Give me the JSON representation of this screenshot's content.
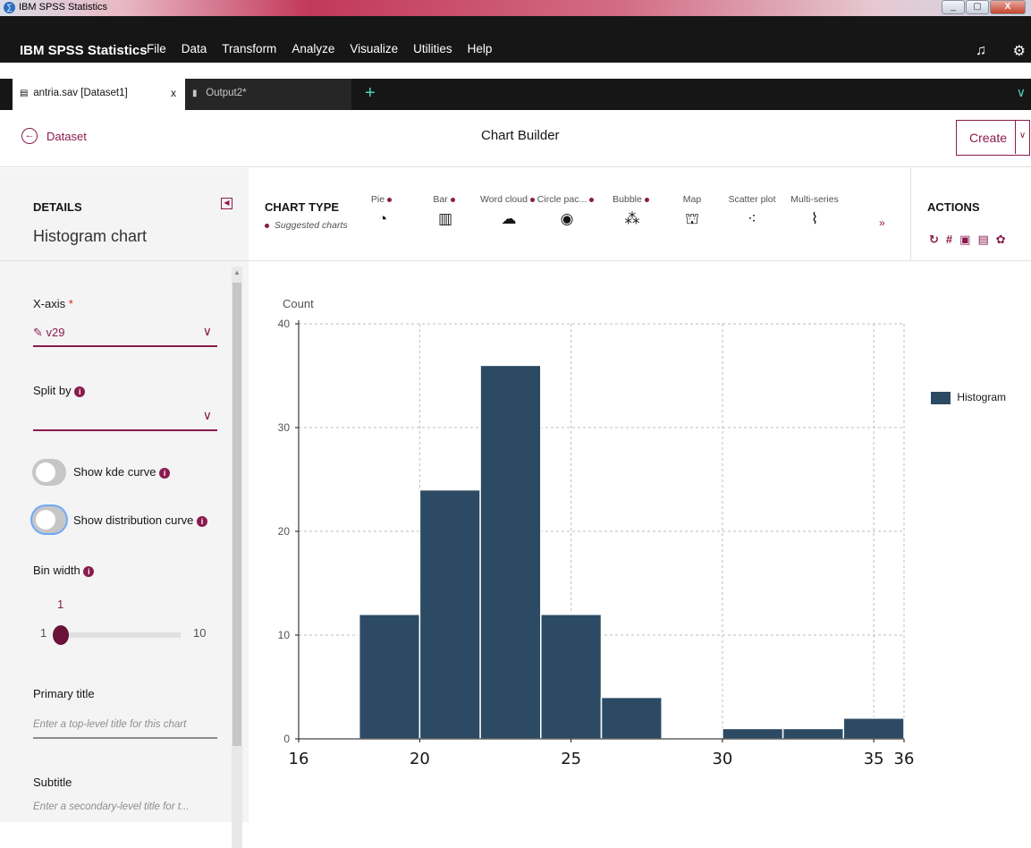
{
  "window": {
    "title": "IBM SPSS Statistics",
    "controls": [
      "_",
      "▢",
      "X"
    ]
  },
  "menubar": {
    "brand": "IBM SPSS Statistics",
    "menus": [
      "File",
      "Data",
      "Transform",
      "Analyze",
      "Visualize",
      "Utilities",
      "Help"
    ],
    "icons": [
      "bell-icon",
      "gear-icon"
    ]
  },
  "tabs": [
    {
      "label": "antria.sav [Dataset1]",
      "icon": "dataset-icon",
      "active": true,
      "close": "x"
    },
    {
      "label": "Output2*",
      "icon": "output-icon",
      "active": false
    }
  ],
  "topbar": {
    "back_label": "Dataset",
    "title": "Chart Builder",
    "create_label": "Create"
  },
  "details": {
    "label": "DETAILS",
    "title": "Histogram chart",
    "xaxis_label": "X-axis",
    "xaxis_required": "*",
    "xaxis_value": "v29",
    "splitby_label": "Split by",
    "kde_label": "Show kde curve",
    "dist_label": "Show distribution curve",
    "binwidth_label": "Bin width",
    "bin_value": "1",
    "bin_min": "1",
    "bin_max": "10",
    "primary_title_label": "Primary title",
    "primary_title_placeholder": "Enter a top-level title for this chart",
    "subtitle_label": "Subtitle",
    "subtitle_placeholder": "Enter a secondary-level title for t..."
  },
  "chart_types": {
    "label": "CHART TYPE",
    "suggested": "Suggested charts",
    "items": [
      {
        "label": "Pie",
        "suggested": true,
        "icon": "pie-icon"
      },
      {
        "label": "Bar",
        "suggested": true,
        "icon": "bar-icon"
      },
      {
        "label": "Word cloud",
        "suggested": true,
        "icon": "word-cloud-icon"
      },
      {
        "label": "Circle pac...",
        "suggested": true,
        "icon": "circle-pack-icon"
      },
      {
        "label": "Bubble",
        "suggested": true,
        "icon": "bubble-icon"
      },
      {
        "label": "Map",
        "suggested": false,
        "icon": "map-icon"
      },
      {
        "label": "Scatter plot",
        "suggested": false,
        "icon": "scatter-icon"
      },
      {
        "label": "Multi-series",
        "suggested": false,
        "icon": "multi-series-icon"
      }
    ]
  },
  "actions": {
    "label": "ACTIONS",
    "icons": [
      "refresh-icon",
      "hash-icon",
      "export-icon",
      "save-icon",
      "settings-icon"
    ]
  },
  "colors": {
    "accent": "#8a1b4d",
    "bar": "#2c4a63",
    "dark": "#161616"
  },
  "chart_data": {
    "type": "bar",
    "ylabel": "Count",
    "xlim": [
      16,
      36
    ],
    "ylim": [
      0,
      40
    ],
    "yticks": [
      0,
      10,
      20,
      30,
      40
    ],
    "xticks": [
      16,
      20,
      25,
      30,
      35,
      36
    ],
    "bins": [
      {
        "start": 18,
        "end": 20,
        "count": 12
      },
      {
        "start": 20,
        "end": 22,
        "count": 24
      },
      {
        "start": 22,
        "end": 24,
        "count": 36
      },
      {
        "start": 24,
        "end": 26,
        "count": 12
      },
      {
        "start": 26,
        "end": 28,
        "count": 4
      },
      {
        "start": 28,
        "end": 30,
        "count": 0
      },
      {
        "start": 30,
        "end": 32,
        "count": 1
      },
      {
        "start": 32,
        "end": 34,
        "count": 1
      },
      {
        "start": 34,
        "end": 36,
        "count": 2
      }
    ],
    "legend": "Histogram",
    "legend_position": "right",
    "grid": true
  }
}
